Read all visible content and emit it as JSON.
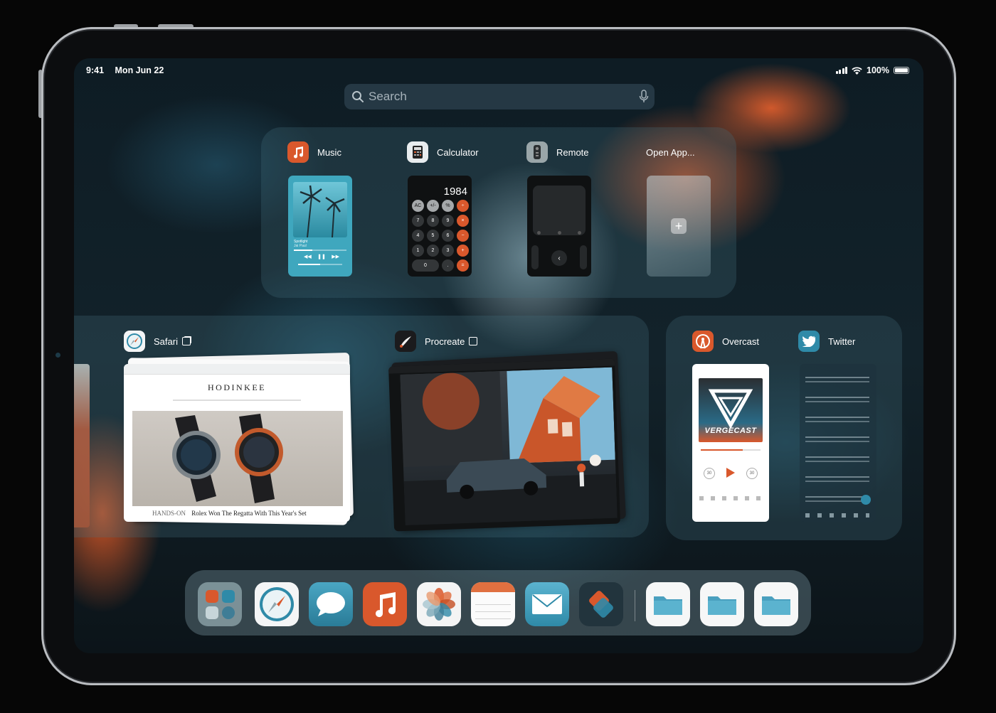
{
  "status_bar": {
    "time": "9:41",
    "date": "Mon Jun 22",
    "battery": "100%"
  },
  "search": {
    "placeholder": "Search"
  },
  "slide_over_apps": [
    {
      "label": "Music",
      "icon": "music-note-icon"
    },
    {
      "label": "Calculator",
      "icon": "calculator-icon"
    },
    {
      "label": "Remote",
      "icon": "remote-icon"
    },
    {
      "label": "Open App...",
      "icon": "plus-icon"
    }
  ],
  "music_widget": {
    "track": "Spotlight",
    "artist": "Jai Paul"
  },
  "calculator": {
    "display": "1984",
    "keys": [
      [
        "AC",
        "+/-",
        "%",
        "÷"
      ],
      [
        "7",
        "8",
        "9",
        "×"
      ],
      [
        "4",
        "5",
        "6",
        "−"
      ],
      [
        "1",
        "2",
        "3",
        "+"
      ],
      [
        "0",
        ".",
        "="
      ]
    ]
  },
  "spaces": [
    {
      "label": "Safari",
      "icon": "safari-compass-icon",
      "windows_icon": "window-stack-icon"
    },
    {
      "label": "Procreate",
      "icon": "procreate-brush-icon",
      "windows_icon": "window-stack-icon"
    }
  ],
  "split_view": [
    {
      "label": "Overcast",
      "icon": "overcast-icon"
    },
    {
      "label": "Twitter",
      "icon": "twitter-bird-icon"
    }
  ],
  "safari_page": {
    "brand": "HODINKEE",
    "headline_prefix": "HANDS-ON",
    "headline": "Rolex Won The Regatta With This Year's Set"
  },
  "overcast_page": {
    "podcast": "VERGECAST",
    "skip_back": "30",
    "skip_forward": "30"
  },
  "dock": {
    "apps": [
      {
        "name": "app-library",
        "icon": "app-library-icon"
      },
      {
        "name": "safari",
        "icon": "safari-compass-icon"
      },
      {
        "name": "messages",
        "icon": "speech-bubble-icon"
      },
      {
        "name": "music",
        "icon": "music-note-icon"
      },
      {
        "name": "photos",
        "icon": "photos-flower-icon"
      },
      {
        "name": "notes",
        "icon": "notes-icon"
      },
      {
        "name": "mail",
        "icon": "envelope-icon"
      },
      {
        "name": "shortcuts",
        "icon": "shortcuts-icon"
      }
    ],
    "folders": [
      {
        "name": "folder-1",
        "icon": "folder-icon"
      },
      {
        "name": "folder-2",
        "icon": "folder-icon"
      },
      {
        "name": "folder-3",
        "icon": "folder-icon"
      }
    ]
  },
  "colors": {
    "accent_orange": "#d9582c",
    "teal": "#2f8aa8",
    "panel": "#46707d"
  }
}
